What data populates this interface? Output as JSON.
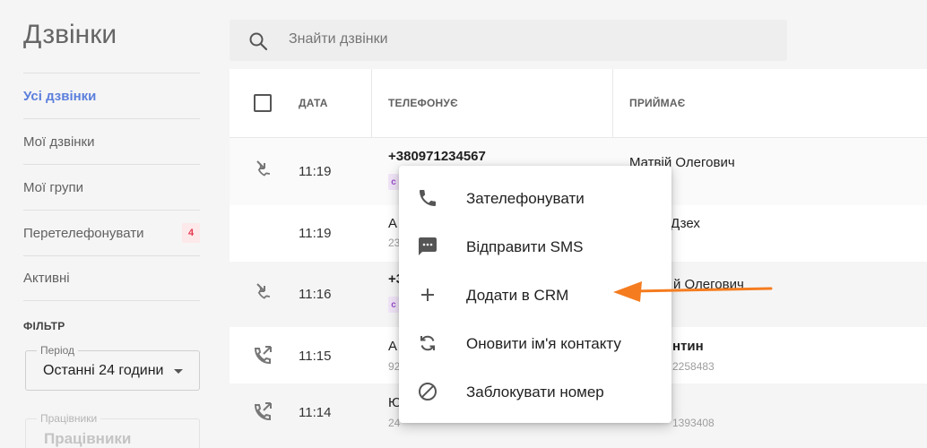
{
  "sidebar": {
    "title": "Дзвінки",
    "items": [
      {
        "label": "Усі дзвінки"
      },
      {
        "label": "Мої дзвінки"
      },
      {
        "label": "Мої групи"
      },
      {
        "label": "Перетелефонувати",
        "badge": "4"
      },
      {
        "label": "Активні"
      }
    ],
    "filter_title": "ФІЛЬТР",
    "period": {
      "legend": "Період",
      "value": "Останні 24 години"
    },
    "workers": {
      "legend": "Працівники",
      "value": "Працівники"
    }
  },
  "search": {
    "placeholder": "Знайти дзвінки"
  },
  "table": {
    "headers": {
      "date": "ДАТА",
      "caller": "ТЕЛЕФОНУЄ",
      "receiver": "ПРИЙМАЄ"
    },
    "rows": [
      {
        "icon": "incoming-call-icon",
        "time": "11:19",
        "caller": "+380971234567",
        "caller_sub": "",
        "tag": "c",
        "receiver": "Матвій Олегович",
        "receiver_sub": ""
      },
      {
        "icon": "",
        "time": "11:19",
        "caller": "А",
        "caller_sub": "23",
        "tag": "",
        "receiver": "Дзех",
        "receiver_sub": ""
      },
      {
        "icon": "incoming-call-icon",
        "time": "11:16",
        "caller": "+3",
        "caller_sub": "",
        "tag": "c",
        "receiver": "й Олегович",
        "receiver_sub": ""
      },
      {
        "icon": "outgoing-call-icon",
        "time": "11:15",
        "caller": "А",
        "caller_sub": "92",
        "tag": "",
        "receiver": "нтин",
        "receiver_sub": "2258483"
      },
      {
        "icon": "outgoing-call-icon",
        "time": "11:14",
        "caller": "Ю",
        "caller_sub": "24",
        "tag": "",
        "receiver": "",
        "receiver_sub": "1393408"
      }
    ]
  },
  "context_menu": {
    "items": [
      {
        "label": "Зателефонувати",
        "icon": "phone-icon"
      },
      {
        "label": "Відправити SMS",
        "icon": "sms-icon"
      },
      {
        "label": "Додати в CRM",
        "icon": "plus-icon"
      },
      {
        "label": "Оновити ім'я контакту",
        "icon": "refresh-icon"
      },
      {
        "label": "Заблокувати номер",
        "icon": "block-icon"
      }
    ]
  },
  "colors": {
    "accent": "#5b7fdc",
    "annotation_arrow": "#f57c1f",
    "badge": "#e53950"
  }
}
